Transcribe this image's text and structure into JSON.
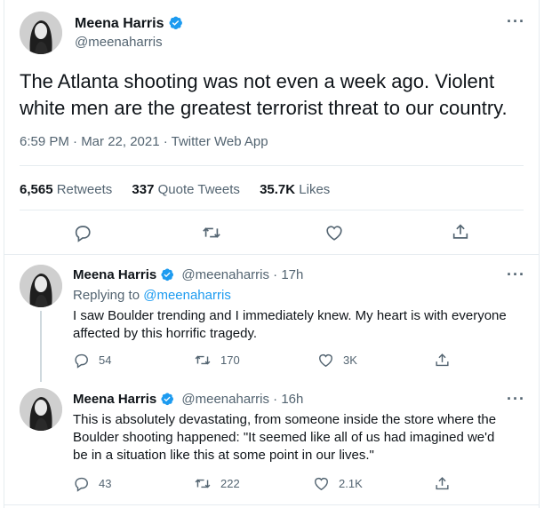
{
  "main_tweet": {
    "author_name": "Meena Harris",
    "author_handle": "@meenaharris",
    "text_line1": "The Atlanta shooting was not even a week ago. Violent",
    "text_line2": "white men are the greatest terrorist threat to our country.",
    "timestamp": "6:59 PM · Mar 22, 2021 · Twitter Web App",
    "more_icon": "more-horizontal-icon",
    "stats": {
      "retweets_count": "6,565",
      "retweets_label": "Retweets",
      "quote_count": "337",
      "quote_label": "Quote Tweets",
      "likes_count": "35.7K",
      "likes_label": "Likes"
    },
    "actions": [
      "reply-icon",
      "retweet-icon",
      "like-icon",
      "share-icon"
    ]
  },
  "replies": [
    {
      "author_name": "Meena Harris",
      "author_handle": "@meenaharris",
      "age": "· 17h",
      "replying_to_label": "Replying to",
      "replying_to_handle": "@meenaharris",
      "text_line1": "I saw Boulder trending and I immediately knew. My heart is with everyone",
      "text_line2": "affected by this horrific tragedy.",
      "reply_count": "54",
      "retweet_count": "170",
      "like_count": "3K"
    },
    {
      "author_name": "Meena Harris",
      "author_handle": "@meenaharris",
      "age": "· 16h",
      "text_line1": "This is absolutely devastating, from someone inside the store where the",
      "text_line2": "Boulder shooting happened: \"It seemed like all of us had imagined we'd",
      "text_line3": "be in a situation like this at some point in our lives.\"",
      "reply_count": "43",
      "retweet_count": "222",
      "like_count": "2.1K"
    }
  ],
  "colors": {
    "text": "#0f1419",
    "secondary": "#536471",
    "link": "#1d9bf0",
    "divider": "#e6ecf0"
  }
}
